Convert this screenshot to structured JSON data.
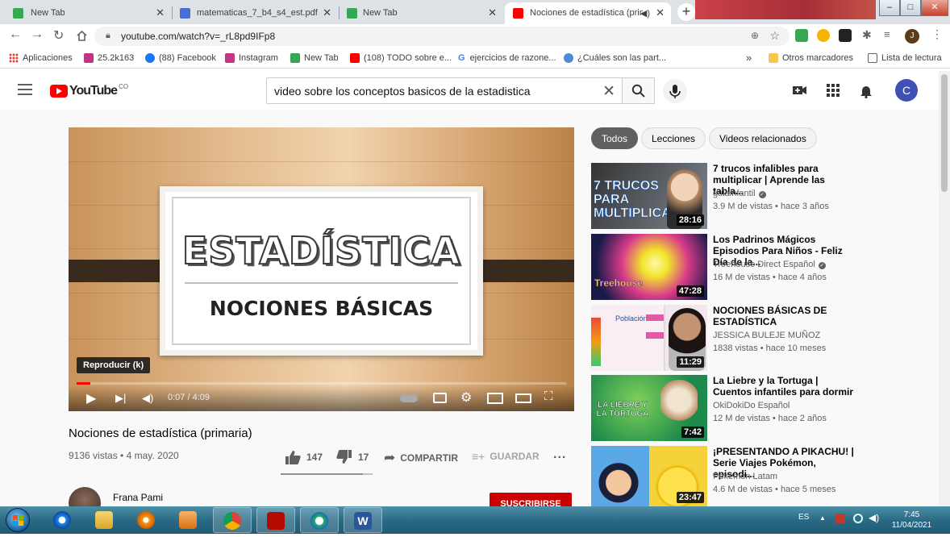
{
  "browser": {
    "tabs": [
      {
        "title": "New Tab",
        "active": false
      },
      {
        "title": "matematicas_7_b4_s4_est.pdf",
        "active": false
      },
      {
        "title": "New Tab",
        "active": false
      },
      {
        "title": "Nociones de estadística (prim",
        "active": true
      }
    ],
    "new_tab": "+",
    "window_buttons": {
      "minimize": "–",
      "maximize": "□",
      "close": "✕"
    },
    "url": "youtube.com/watch?v=_rL8pd9IFp8",
    "profile_initial": "J",
    "bookmarks": [
      {
        "label": "Aplicaciones",
        "color": "#e94235"
      },
      {
        "label": "25.2k163",
        "color": "#c13584"
      },
      {
        "label": "(88) Facebook",
        "color": "#1877f2"
      },
      {
        "label": "Instagram",
        "color": "#c13584"
      },
      {
        "label": "New Tab",
        "color": "#34a853"
      },
      {
        "label": "(108) TODO sobre e...",
        "color": "#ff0000"
      },
      {
        "label": "ejercicios de razone...",
        "color": "#4285f4"
      },
      {
        "label": "¿Cuáles son las part...",
        "color": "#4e8bd6"
      }
    ],
    "bookmarks_more": "»",
    "other_bookmarks": "Otros marcadores",
    "reading_list": "Lista de lectura"
  },
  "youtube": {
    "logo_text": "YouTube",
    "country": "CO",
    "search_query": "video sobre los conceptos basicos de la estadistica",
    "avatar_initial": "C"
  },
  "video": {
    "thumbnail_title": "ESTADÍSTICA",
    "thumbnail_subtitle": "NOCIONES BÁSICAS",
    "tooltip": "Reproducir (k)",
    "time": "0:07 / 4:09",
    "progress_fraction": 0.028,
    "title": "Nociones de estadística (primaria)",
    "meta": "9136 vistas • 4 may. 2020",
    "likes": "147",
    "dislikes": "17",
    "like_ratio": 0.896,
    "share": "COMPARTIR",
    "save": "GUARDAR",
    "more": "...",
    "channel": "Frana Pami",
    "subscribe": "SUSCRIBIRSE"
  },
  "chips": [
    {
      "label": "Todos",
      "active": true
    },
    {
      "label": "Lecciones",
      "active": false
    },
    {
      "label": "Videos relacionados",
      "active": false
    }
  ],
  "recommendations": [
    {
      "title": "7 trucos infalibles para multiplicar | Aprende las tabla...",
      "channel": "guiainfantil",
      "verified": true,
      "views": "3.9 M de vistas • hace 3 años",
      "duration": "28:16",
      "thumb_text": "7 TRUCOS PARA MULTIPLICAR",
      "thumb_colors": [
        "#3a3a3a",
        "#8a8f99"
      ]
    },
    {
      "title": "Los Padrinos Mágicos Episodios Para Niños - Feliz Día de la...",
      "channel": "Treehouse Direct Español",
      "verified": true,
      "views": "16 M de vistas • hace 4 años",
      "duration": "47:28",
      "thumb_text": "Treehouse",
      "thumb_colors": [
        "#1a1a4a",
        "#d93b8a"
      ]
    },
    {
      "title": "NOCIONES BÁSICAS DE ESTADÍSTICA",
      "channel": "JESSICA BULEJE MUÑOZ",
      "verified": false,
      "views": "1838 vistas • hace 10 meses",
      "duration": "11:29",
      "thumb_text": "Población",
      "thumb_colors": [
        "#f3e7ee",
        "#e05aa7"
      ]
    },
    {
      "title": "La Liebre y la Tortuga | Cuentos infantiles para dormir",
      "channel": "OkiDokiDo Español",
      "verified": false,
      "views": "12 M de vistas • hace 2 años",
      "duration": "7:42",
      "thumb_text": "LA LIEBRE Y LA TORTUGA",
      "thumb_colors": [
        "#1c8a4a",
        "#7fd05a"
      ]
    },
    {
      "title": "¡PRESENTANDO A PIKACHU! | Serie Viajes Pokémon, episodi...",
      "channel": "Pokémon Latam",
      "verified": false,
      "views": "4.6 M de vistas • hace 5 meses",
      "duration": "23:47",
      "thumb_text": "",
      "thumb_colors": [
        "#5aa9e6",
        "#f6d23a"
      ]
    }
  ],
  "taskbar": {
    "language": "ES",
    "time": "7:45",
    "date": "11/04/2021"
  }
}
